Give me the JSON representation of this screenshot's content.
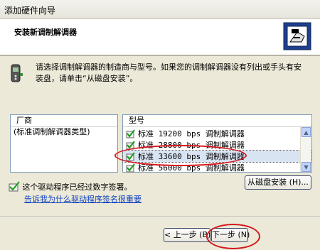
{
  "window": {
    "title": "添加硬件向导"
  },
  "header": {
    "title": "安装新调制解调器"
  },
  "instruction": "请选择调制解调器的制造商与型号。如果您的调制解调器没有列出或手头有安装盘，请单击“从磁盘安装”。",
  "manufacturer": {
    "header": "厂商",
    "items": [
      "(标准调制解调器类型)"
    ]
  },
  "model": {
    "header": "型号",
    "items": [
      "标准 19200 bps 调制解调器",
      "标准 28800 bps 调制解调器",
      "标准 33600 bps 调制解调器",
      "标准 56000 bps 调制解调器"
    ],
    "selected_index": 2
  },
  "signed": {
    "text": "这个驱动程序已经过数字签署。",
    "link": "告诉我为什么驱动程序签名很重要"
  },
  "buttons": {
    "have_disk": "从磁盘安装 (H)...",
    "back": "< 上一步 (B)",
    "next": "下一步 (N)"
  },
  "colors": {
    "annotation": "#d6151c",
    "link": "#0b3fbf",
    "panel": "#ece9d8"
  }
}
